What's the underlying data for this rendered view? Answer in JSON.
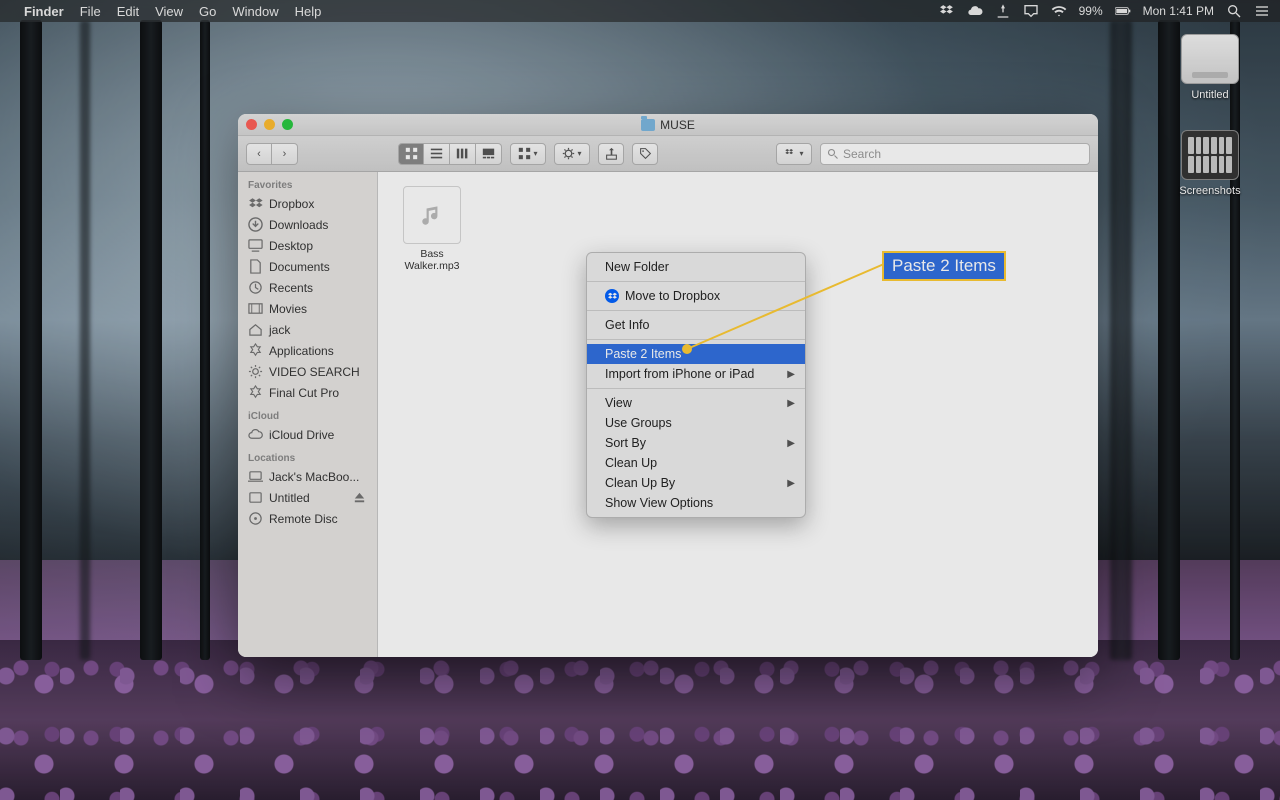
{
  "menubar": {
    "app": "Finder",
    "items": [
      "File",
      "Edit",
      "View",
      "Go",
      "Window",
      "Help"
    ],
    "battery": "99%",
    "clock": "Mon 1:41 PM"
  },
  "desktop_icons": {
    "drive": "Untitled",
    "screenshots": "Screenshots"
  },
  "finder": {
    "title": "MUSE",
    "search_placeholder": "Search",
    "sidebar": {
      "favorites_header": "Favorites",
      "favorites": [
        {
          "label": "Dropbox",
          "icon": "dropbox"
        },
        {
          "label": "Downloads",
          "icon": "download"
        },
        {
          "label": "Desktop",
          "icon": "desktop"
        },
        {
          "label": "Documents",
          "icon": "doc"
        },
        {
          "label": "Recents",
          "icon": "clock"
        },
        {
          "label": "Movies",
          "icon": "movie"
        },
        {
          "label": "jack",
          "icon": "home"
        },
        {
          "label": "Applications",
          "icon": "apps"
        },
        {
          "label": "VIDEO SEARCH",
          "icon": "gear"
        },
        {
          "label": "Final Cut Pro",
          "icon": "app"
        }
      ],
      "icloud_header": "iCloud",
      "icloud": [
        {
          "label": "iCloud Drive",
          "icon": "cloud"
        }
      ],
      "locations_header": "Locations",
      "locations": [
        {
          "label": "Jack's MacBoo...",
          "icon": "laptop"
        },
        {
          "label": "Untitled",
          "icon": "disk",
          "eject": true
        },
        {
          "label": "Remote Disc",
          "icon": "disc"
        }
      ]
    },
    "files": [
      {
        "name": "Bass Walker.mp3"
      }
    ]
  },
  "context_menu": {
    "items": [
      {
        "label": "New Folder"
      },
      {
        "sep": true
      },
      {
        "label": "Move to Dropbox",
        "icon": "dropbox"
      },
      {
        "sep": true
      },
      {
        "label": "Get Info"
      },
      {
        "sep": true
      },
      {
        "label": "Paste 2 Items",
        "highlight": true
      },
      {
        "label": "Import from iPhone or iPad",
        "submenu": true
      },
      {
        "sep": true
      },
      {
        "label": "View",
        "submenu": true
      },
      {
        "label": "Use Groups"
      },
      {
        "label": "Sort By",
        "submenu": true
      },
      {
        "label": "Clean Up"
      },
      {
        "label": "Clean Up By",
        "submenu": true
      },
      {
        "label": "Show View Options"
      }
    ]
  },
  "callout": {
    "text": "Paste 2 Items"
  }
}
